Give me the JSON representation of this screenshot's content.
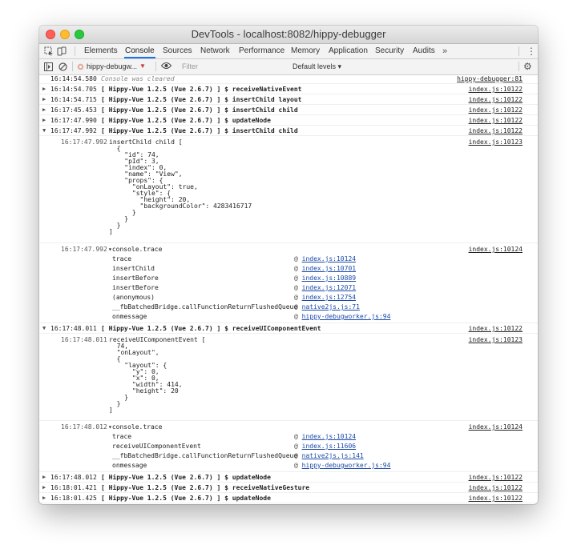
{
  "window": {
    "title": "DevTools - localhost:8082/hippy-debugger"
  },
  "tabs": [
    "Elements",
    "Console",
    "Sources",
    "Network",
    "Performance",
    "Memory",
    "Application",
    "Security",
    "Audits"
  ],
  "tabs_more": "»",
  "toolbar": {
    "context": "hippy-debugw...",
    "filter_placeholder": "Filter",
    "levels": "Default levels ▾"
  },
  "console": {
    "cleared": {
      "ts": "16:14:54.580",
      "text": "Console was cleared",
      "src": "hippy-debugger:81"
    },
    "msg1": {
      "ts": "16:14:54.705",
      "text": "[ Hippy-Vue 1.2.5 (Vue 2.6.7) ] $ receiveNativeEvent",
      "src": "index.js:10122"
    },
    "msg2": {
      "ts": "16:14:54.715",
      "text": "[ Hippy-Vue 1.2.5 (Vue 2.6.7) ] $ insertChild layout",
      "src": "index.js:10122"
    },
    "msg3": {
      "ts": "16:17:45.453",
      "text": "[ Hippy-Vue 1.2.5 (Vue 2.6.7) ] $ insertChild child",
      "src": "index.js:10122"
    },
    "msg4": {
      "ts": "16:17:47.990",
      "text": "[ Hippy-Vue 1.2.5 (Vue 2.6.7) ] $ updateNode",
      "src": "index.js:10122"
    },
    "msg5": {
      "ts": "16:17:47.992",
      "text": "[ Hippy-Vue 1.2.5 (Vue 2.6.7) ] $ insertChild child",
      "src": "index.js:10122"
    },
    "sub1": {
      "ts": "16:17:47.992",
      "src": "index.js:10123",
      "lines": [
        "insertChild child [",
        "  {",
        "    \"id\": 74,",
        "    \"pId\": 3,",
        "    \"index\": 0,",
        "    \"name\": \"View\",",
        "    \"props\": {",
        "      \"onLayout\": true,",
        "      \"style\": {",
        "        \"height\": 20,",
        "        \"backgroundColor\": 4283416717",
        "      }",
        "    }",
        "  }",
        "]"
      ]
    },
    "trace1": {
      "ts": "16:17:47.992",
      "label": "console.trace",
      "src": "index.js:10124",
      "frames": [
        {
          "fn": "trace",
          "loc": "index.js:10124"
        },
        {
          "fn": "insertChild",
          "loc": "index.js:10701"
        },
        {
          "fn": "insertBefore",
          "loc": "index.js:10889"
        },
        {
          "fn": "insertBefore",
          "loc": "index.js:12071"
        },
        {
          "fn": "(anonymous)",
          "loc": "index.js:12754"
        },
        {
          "fn": "__fbBatchedBridge.callFunctionReturnFlushedQueue",
          "loc": "native2js.js:71"
        },
        {
          "fn": "onmessage",
          "loc": "hippy-debugworker.js:94"
        }
      ]
    },
    "msg6": {
      "ts": "16:17:48.011",
      "text": "[ Hippy-Vue 1.2.5 (Vue 2.6.7) ] $ receiveUIComponentEvent",
      "src": "index.js:10122"
    },
    "sub2": {
      "ts": "16:17:48.011",
      "src": "index.js:10123",
      "lines": [
        "receiveUIComponentEvent [",
        "  74,",
        "  \"onLayout\",",
        "  {",
        "    \"layout\": {",
        "      \"y\": 0,",
        "      \"x\": 0,",
        "      \"width\": 414,",
        "      \"height\": 20",
        "    }",
        "  }",
        "]"
      ]
    },
    "trace2": {
      "ts": "16:17:48.012",
      "label": "console.trace",
      "src": "index.js:10124",
      "frames": [
        {
          "fn": "trace",
          "loc": "index.js:10124"
        },
        {
          "fn": "receiveUIComponentEvent",
          "loc": "index.js:11606"
        },
        {
          "fn": "__fbBatchedBridge.callFunctionReturnFlushedQueue",
          "loc": "native2js.js:141"
        },
        {
          "fn": "onmessage",
          "loc": "hippy-debugworker.js:94"
        }
      ]
    },
    "msg7": {
      "ts": "16:17:48.012",
      "text": "[ Hippy-Vue 1.2.5 (Vue 2.6.7) ] $ updateNode",
      "src": "index.js:10122"
    },
    "msg8": {
      "ts": "16:18:01.421",
      "text": "[ Hippy-Vue 1.2.5 (Vue 2.6.7) ] $ receiveNativeGesture",
      "src": "index.js:10122"
    },
    "msg9": {
      "ts": "16:18:01.425",
      "text": "[ Hippy-Vue 1.2.5 (Vue 2.6.7) ] $ updateNode",
      "src": "index.js:10122"
    }
  }
}
